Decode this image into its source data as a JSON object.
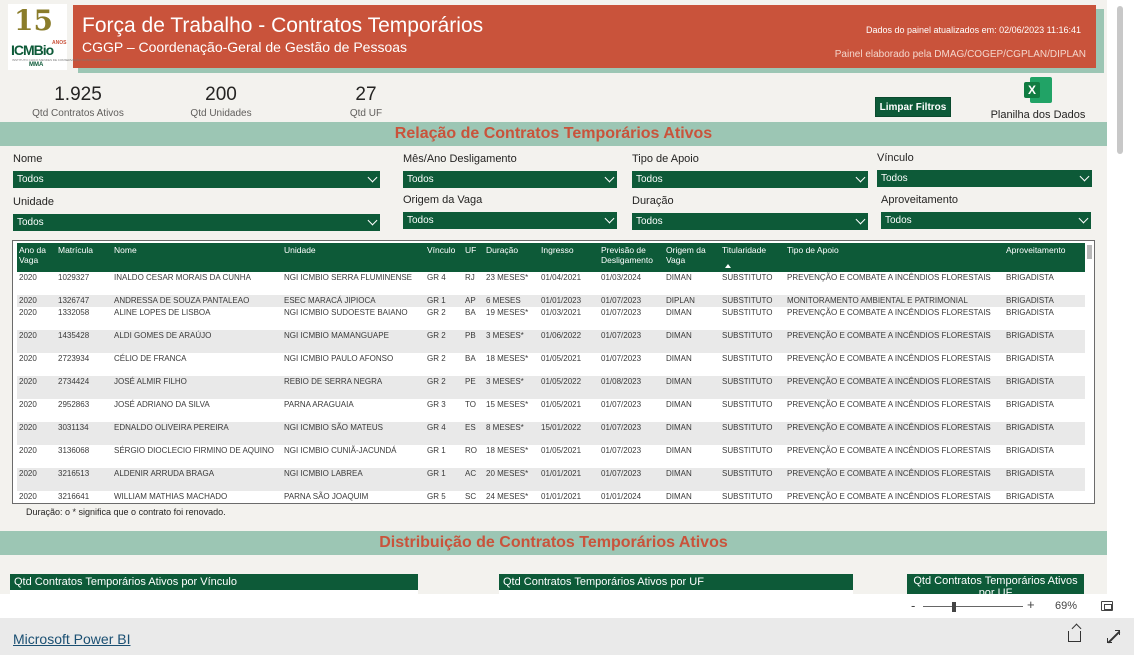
{
  "header": {
    "title": "Força de Trabalho - Contratos Temporários",
    "subtitle": "CGGP – Coordenação-Geral de Gestão de Pessoas",
    "updated": "Dados do painel atualizados em: 02/06/2023 11:16:41",
    "credits": "Painel elaborado pela DMAG/COGEP/CGPLAN/DIPLAN",
    "colors": {
      "header_bg": "#c9533b",
      "accent_green": "#0d5a38",
      "section_bg": "#9cc6b4"
    }
  },
  "logo": {
    "number": "15",
    "anos": "ANOS",
    "brand": "ICMBio",
    "tagline": "INSTITUTO CHICO MENDES DE CONSERVAÇÃO DA BIODIVERSIDADE",
    "ministry": "MMA"
  },
  "kpis": [
    {
      "value": "1.925",
      "label": "Qtd Contratos Ativos"
    },
    {
      "value": "200",
      "label": "Qtd Unidades"
    },
    {
      "value": "27",
      "label": "Qtd UF"
    }
  ],
  "actions": {
    "clear_filters": "Limpar Filtros",
    "spreadsheet": "Planilha dos Dados",
    "excel_icon": "excel-icon"
  },
  "section1": {
    "title": "Relação de Contratos Temporários Ativos"
  },
  "slicers": [
    {
      "label": "Nome",
      "value": "Todos"
    },
    {
      "label": "Mês/Ano Desligamento",
      "value": "Todos"
    },
    {
      "label": "Tipo de Apoio",
      "value": "Todos"
    },
    {
      "label": "Vínculo",
      "value": "Todos"
    },
    {
      "label": "Unidade",
      "value": "Todos"
    },
    {
      "label": "Origem da Vaga",
      "value": "Todos"
    },
    {
      "label": "Duração",
      "value": "Todos"
    },
    {
      "label": "Aproveitamento",
      "value": "Todos"
    }
  ],
  "table": {
    "columns": [
      "Ano da Vaga",
      "Matrícula",
      "Nome",
      "Unidade",
      "Vínculo",
      "UF",
      "Duração",
      "Ingresso",
      "Previsão de Desligamento",
      "Origem da Vaga",
      "Titularidade",
      "Tipo de Apoio",
      "Aproveitamento"
    ],
    "rows": [
      [
        "2020",
        "1029327",
        "INALDO CESAR MORAIS DA CUNHA",
        "NGI ICMBIO SERRA FLUMINENSE",
        "GR 4",
        "RJ",
        "23 MESES*",
        "01/04/2021",
        "01/03/2024",
        "DIMAN",
        "SUBSTITUTO",
        "PREVENÇÃO E COMBATE A INCÊNDIOS FLORESTAIS",
        "BRIGADISTA"
      ],
      [
        "2020",
        "1326747",
        "ANDRESSA DE SOUZA PANTALEAO",
        "ESEC MARACÁ JIPIOCA",
        "GR 1",
        "AP",
        "6 MESES",
        "01/01/2023",
        "01/07/2023",
        "DIPLAN",
        "SUBSTITUTO",
        "MONITORAMENTO AMBIENTAL E PATRIMONIAL",
        "BRIGADISTA"
      ],
      [
        "2020",
        "1332058",
        "ALINE LOPES DE LISBOA",
        "NGI ICMBIO SUDOESTE BAIANO",
        "GR 2",
        "BA",
        "19 MESES*",
        "01/03/2021",
        "01/07/2023",
        "DIMAN",
        "SUBSTITUTO",
        "PREVENÇÃO E COMBATE A INCÊNDIOS FLORESTAIS",
        "BRIGADISTA"
      ],
      [
        "2020",
        "1435428",
        "ALDI GOMES DE ARAÚJO",
        "NGI ICMBIO MAMANGUAPE",
        "GR 2",
        "PB",
        "3 MESES*",
        "01/06/2022",
        "01/07/2023",
        "DIMAN",
        "SUBSTITUTO",
        "PREVENÇÃO E COMBATE A INCÊNDIOS FLORESTAIS",
        "BRIGADISTA"
      ],
      [
        "2020",
        "2723934",
        "CÉLIO DE FRANCA",
        "NGI ICMBIO PAULO AFONSO",
        "GR 2",
        "BA",
        "18 MESES*",
        "01/05/2021",
        "01/07/2023",
        "DIMAN",
        "SUBSTITUTO",
        "PREVENÇÃO E COMBATE A INCÊNDIOS FLORESTAIS",
        "BRIGADISTA"
      ],
      [
        "2020",
        "2734424",
        "JOSÉ ALMIR FILHO",
        "REBIO DE SERRA NEGRA",
        "GR 2",
        "PE",
        "3 MESES*",
        "01/05/2022",
        "01/08/2023",
        "DIMAN",
        "SUBSTITUTO",
        "PREVENÇÃO E COMBATE A INCÊNDIOS FLORESTAIS",
        "BRIGADISTA"
      ],
      [
        "2020",
        "2952863",
        "JOSÉ ADRIANO DA SILVA",
        "PARNA ARAGUAIA",
        "GR 3",
        "TO",
        "15 MESES*",
        "01/05/2021",
        "01/07/2023",
        "DIMAN",
        "SUBSTITUTO",
        "PREVENÇÃO E COMBATE A INCÊNDIOS FLORESTAIS",
        "BRIGADISTA"
      ],
      [
        "2020",
        "3031134",
        "EDNALDO OLIVEIRA PEREIRA",
        "NGI ICMBIO SÃO MATEUS",
        "GR 4",
        "ES",
        "8 MESES*",
        "15/01/2022",
        "01/07/2023",
        "DIMAN",
        "SUBSTITUTO",
        "PREVENÇÃO E COMBATE A INCÊNDIOS FLORESTAIS",
        "BRIGADISTA"
      ],
      [
        "2020",
        "3136068",
        "SÉRGIO DIOCLECIO FIRMINO DE AQUINO",
        "NGI ICMBIO CUNIÃ-JACUNDÁ",
        "GR 1",
        "RO",
        "18 MESES*",
        "01/05/2021",
        "01/07/2023",
        "DIMAN",
        "SUBSTITUTO",
        "PREVENÇÃO E COMBATE A INCÊNDIOS FLORESTAIS",
        "BRIGADISTA"
      ],
      [
        "2020",
        "3216513",
        "ALDENIR ARRUDA BRAGA",
        "NGI ICMBIO LABREA",
        "GR 1",
        "AC",
        "20 MESES*",
        "01/01/2021",
        "01/07/2023",
        "DIMAN",
        "SUBSTITUTO",
        "PREVENÇÃO E COMBATE A INCÊNDIOS FLORESTAIS",
        "BRIGADISTA"
      ],
      [
        "2020",
        "3216641",
        "WILLIAM MATHIAS MACHADO",
        "PARNA SÃO JOAQUIM",
        "GR 5",
        "SC",
        "24 MESES*",
        "01/01/2021",
        "01/01/2024",
        "DIMAN",
        "SUBSTITUTO",
        "PREVENÇÃO E COMBATE A INCÊNDIOS FLORESTAIS",
        "BRIGADISTA"
      ]
    ]
  },
  "note": "Duração: o * significa que o contrato foi renovado.",
  "section2": {
    "title": "Distribuição de Contratos Temporários Ativos"
  },
  "cards": [
    "Qtd Contratos Temporários Ativos por Vínculo",
    "Qtd Contratos Temporários Ativos por UF",
    "Qtd Contratos Temporários Ativos por UF"
  ],
  "zoom": {
    "minus": "-",
    "plus": "+",
    "percent": "69%"
  },
  "footer": {
    "powerbi": "Microsoft Power BI"
  }
}
